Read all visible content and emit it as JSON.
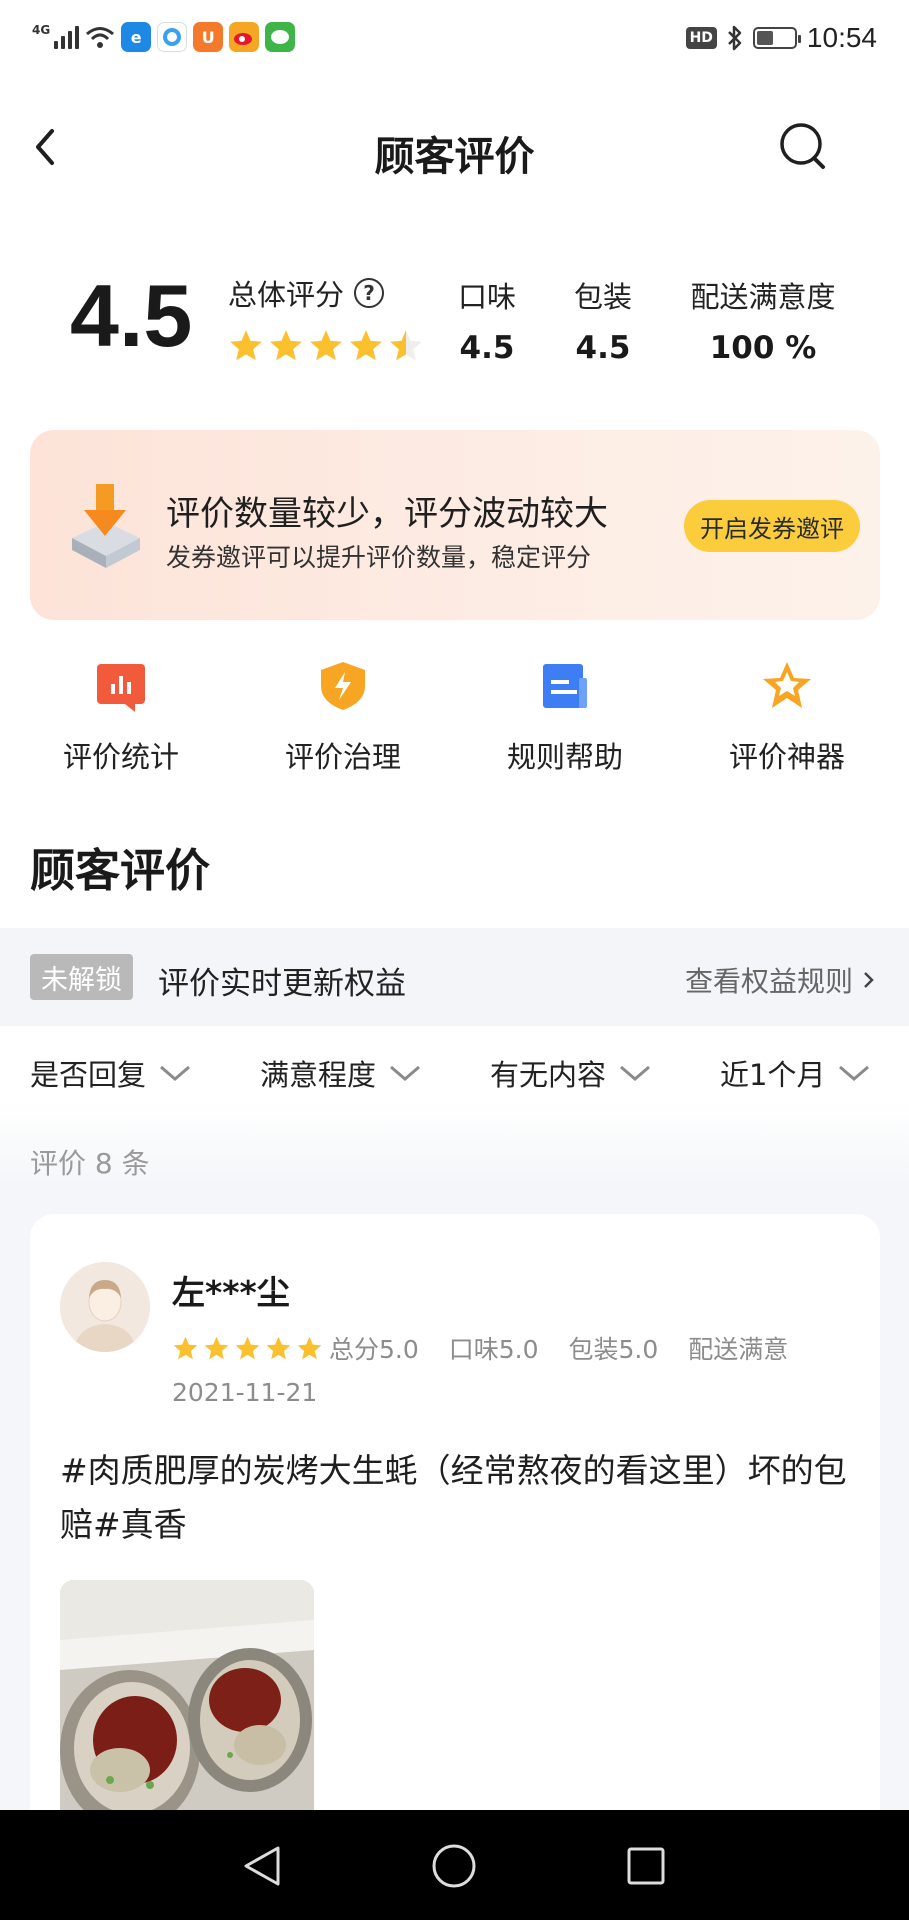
{
  "status_bar": {
    "network": "4G",
    "hd": "HD",
    "time": "10:54",
    "battery_level": 0.45,
    "app_icons": [
      "blue-app-icon",
      "qq-browser-icon",
      "uc-browser-icon",
      "weibo-icon",
      "wechat-like-icon"
    ]
  },
  "nav": {
    "title": "顾客评价"
  },
  "scores": {
    "overall": "4.5",
    "overall_label": "总体评分",
    "overall_stars": 4.5,
    "taste_label": "口味",
    "taste_value": "4.5",
    "packaging_label": "包装",
    "packaging_value": "4.5",
    "delivery_label": "配送满意度",
    "delivery_value": "100 %"
  },
  "banner": {
    "title": "评价数量较少，评分波动较大",
    "subtitle": "发券邀评可以提升评价数量，稳定评分",
    "button": "开启发券邀评"
  },
  "tools": [
    {
      "label": "评价统计",
      "icon": "bar-chart-icon"
    },
    {
      "label": "评价治理",
      "icon": "shield-icon"
    },
    {
      "label": "规则帮助",
      "icon": "document-icon"
    },
    {
      "label": "评价神器",
      "icon": "star-icon"
    }
  ],
  "section": {
    "title": "顾客评价"
  },
  "rights": {
    "badge": "未解锁",
    "text": "评价实时更新权益",
    "link": "查看权益规则"
  },
  "filters": [
    "是否回复",
    "满意程度",
    "有无内容",
    "近1个月"
  ],
  "review_count": "评价 8 条",
  "review": {
    "user": "左***尘",
    "stars": 5,
    "total": "总分5.0",
    "taste": "口味5.0",
    "packaging": "包装5.0",
    "delivery": "配送满意",
    "date": "2021-11-21",
    "text": "#肉质肥厚的炭烤大生蚝（经常熬夜的看这里）坏的包赔#真香"
  },
  "colors": {
    "star": "#fbc02d",
    "banner_button": "#fbcd3c",
    "tool_red": "#f25a3c",
    "tool_orange": "#f7a523",
    "tool_blue": "#3d7ef5"
  }
}
